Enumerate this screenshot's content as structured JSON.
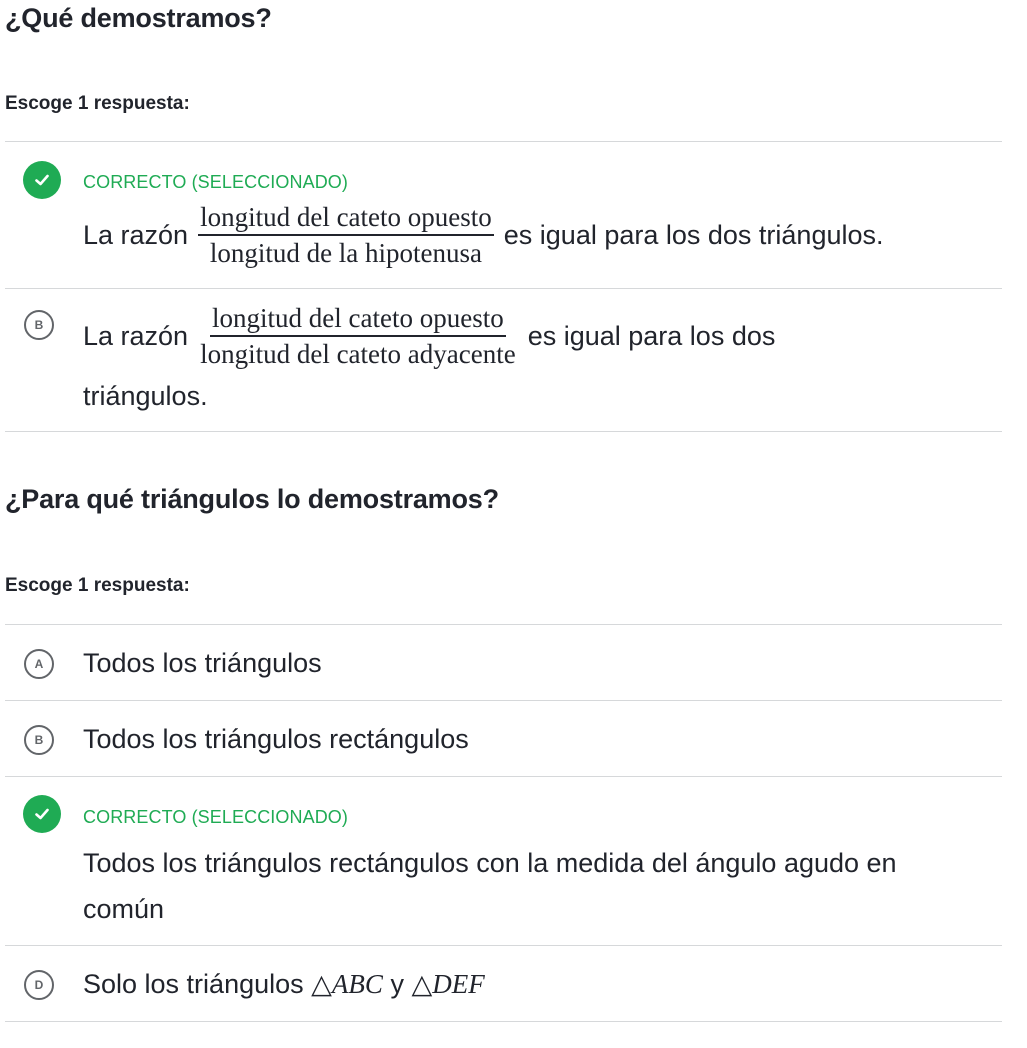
{
  "q1": {
    "title": "¿Qué demostramos?",
    "instruction": "Escoge 1 respuesta:",
    "choices": [
      {
        "status": "CORRECTO (SELECCIONADO)",
        "prefix": "La razón",
        "numerator": "longitud del cateto opuesto",
        "denominator": "longitud de la hipotenusa",
        "suffix": "es igual para los dos triángulos."
      },
      {
        "letter": "B",
        "prefix": "La razón",
        "numerator": "longitud del cateto opuesto",
        "denominator": "longitud del cateto adyacente",
        "suffix": "es igual para los dos",
        "continuation": "triángulos."
      }
    ]
  },
  "q2": {
    "title": "¿Para qué triángulos lo demostramos?",
    "instruction": "Escoge 1 respuesta:",
    "choices": [
      {
        "letter": "A",
        "text": "Todos los triángulos"
      },
      {
        "letter": "B",
        "text": "Todos los triángulos rectángulos"
      },
      {
        "status": "CORRECTO (SELECCIONADO)",
        "line1": "Todos los triángulos rectángulos con la medida del ángulo agudo en",
        "line2": "común"
      },
      {
        "letter": "D",
        "text_before": "Solo los triángulos",
        "tri_symbol": "△",
        "tri1": "ABC",
        "connector": "y",
        "tri2": "DEF"
      }
    ]
  },
  "colors": {
    "correct": "#1fab54",
    "text": "#21242c",
    "divider": "#d6d8da",
    "letter_circle": "#626569"
  },
  "icons": {
    "check": "check-icon"
  }
}
